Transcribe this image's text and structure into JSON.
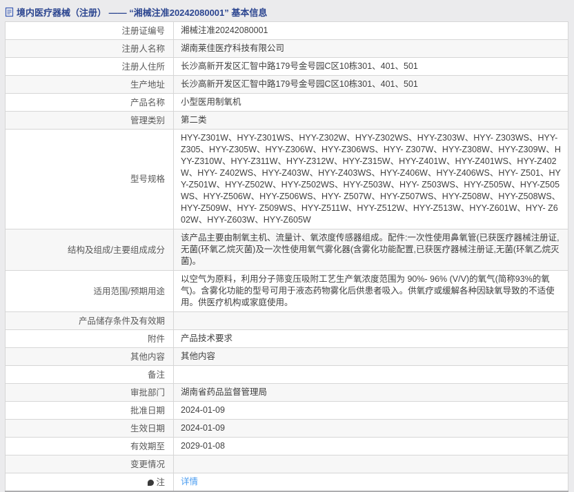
{
  "page": {
    "title": "境内医疗器械（注册） ——  “湘械注准20242080001”  基本信息"
  },
  "colors": {
    "title_text": "#2b4590",
    "link": "#4a9cf0",
    "row_stripe": "#f7f7f7",
    "border": "#d6d6d6"
  },
  "table": {
    "rows": [
      {
        "label": "注册证编号",
        "value": "湘械注准20242080001",
        "value_type": "text",
        "icon": null
      },
      {
        "label": "注册人名称",
        "value": "湖南莱佳医疗科技有限公司",
        "value_type": "text",
        "icon": null
      },
      {
        "label": "注册人住所",
        "value": "长沙高新开发区汇智中路179号金号园C区10栋301、401、501",
        "value_type": "text",
        "icon": null
      },
      {
        "label": "生产地址",
        "value": "长沙高新开发区汇智中路179号金号园C区10栋301、401、501",
        "value_type": "text",
        "icon": null
      },
      {
        "label": "产品名称",
        "value": "小型医用制氧机",
        "value_type": "text",
        "icon": null
      },
      {
        "label": "管理类别",
        "value": "第二类",
        "value_type": "text",
        "icon": null
      },
      {
        "label": "型号规格",
        "value": "HYY-Z301W、HYY-Z301WS、HYY-Z302W、HYY-Z302WS、HYY-Z303W、HYY- Z303WS、HYY-Z305、HYY-Z305W、HYY-Z306W、HYY-Z306WS、HYY- Z307W、HYY-Z308W、HYY-Z309W、HYY-Z310W、HYY-Z311W、HYY-Z312W、HYY-Z315W、HYY-Z401W、HYY-Z401WS、HYY-Z402W、HYY- Z402WS、HYY-Z403W、HYY-Z403WS、HYY-Z406W、HYY-Z406WS、HYY- Z501、HYY-Z501W、HYY-Z502W、HYY-Z502WS、HYY-Z503W、HYY- Z503WS、HYY-Z505W、HYY-Z505WS、HYY-Z506W、HYY-Z506WS、HYY- Z507W、HYY-Z507WS、HYY-Z508W、HYY-Z508WS、HYY-Z509W、HYY- Z509WS、HYY-Z511W、HYY-Z512W、HYY-Z513W、HYY-Z601W、HYY- Z602W、HYY-Z603W、HYY-Z605W",
        "value_type": "text",
        "icon": null
      },
      {
        "label": "结构及组成/主要组成成分",
        "value": "该产品主要由制氧主机、流量计、氧浓度传感器组成。配件:一次性使用鼻氧管(已获医疗器械注册证,无菌(环氧乙烷灭菌)及一次性使用氧气雾化器(含雾化功能配置,已获医疗器械注册证,无菌(环氧乙烷灭菌)。",
        "value_type": "text",
        "icon": null
      },
      {
        "label": "适用范围/预期用途",
        "value": "以空气为原料，利用分子筛变压吸附工艺生产氧浓度范围为 90%- 96% (V/V)的氧气(简称93%的氧气)。含雾化功能的型号可用于液态药物雾化后供患者吸入。供氧疗或缓解各种因缺氧导致的不适使用。供医疗机构或家庭使用。",
        "value_type": "text",
        "icon": null
      },
      {
        "label": "产品储存条件及有效期",
        "value": "",
        "value_type": "text",
        "icon": null
      },
      {
        "label": "附件",
        "value": "产品技术要求",
        "value_type": "text",
        "icon": null
      },
      {
        "label": "其他内容",
        "value": "其他内容",
        "value_type": "text",
        "icon": null
      },
      {
        "label": "备注",
        "value": "",
        "value_type": "text",
        "icon": null
      },
      {
        "label": "审批部门",
        "value": "湖南省药品监督管理局",
        "value_type": "text",
        "icon": null
      },
      {
        "label": "批准日期",
        "value": "2024-01-09",
        "value_type": "text",
        "icon": null
      },
      {
        "label": "生效日期",
        "value": "2024-01-09",
        "value_type": "text",
        "icon": null
      },
      {
        "label": "有效期至",
        "value": "2029-01-08",
        "value_type": "text",
        "icon": null
      },
      {
        "label": "变更情况",
        "value": "",
        "value_type": "text",
        "icon": null
      },
      {
        "label": "注",
        "value": "详情",
        "value_type": "link",
        "icon": "note"
      }
    ]
  }
}
